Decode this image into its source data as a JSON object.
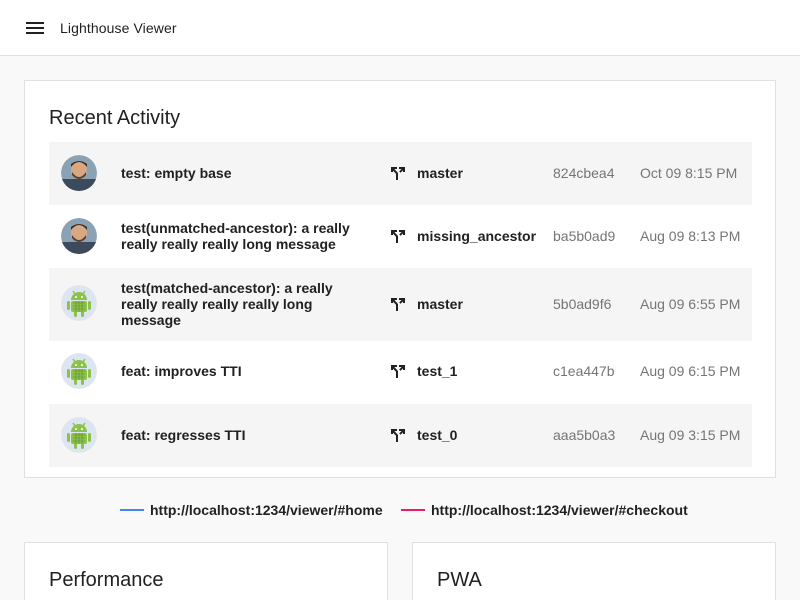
{
  "app": {
    "title": "Lighthouse Viewer"
  },
  "activity": {
    "title": "Recent Activity",
    "rows": [
      {
        "avatar": "person-avatar",
        "message": "test: empty base",
        "branch": "master",
        "hash": "824cbea4",
        "date": "Oct 09 8:15 PM"
      },
      {
        "avatar": "person-avatar",
        "message": "test(unmatched-ancestor): a really really really really long message",
        "branch": "missing_ancestor",
        "hash": "ba5b0ad9",
        "date": "Aug 09 8:13 PM"
      },
      {
        "avatar": "android-avatar",
        "message": "test(matched-ancestor): a really really really really really long message",
        "branch": "master",
        "hash": "5b0ad9f6",
        "date": "Aug 09 6:55 PM"
      },
      {
        "avatar": "android-avatar",
        "message": "feat: improves TTI",
        "branch": "test_1",
        "hash": "c1ea447b",
        "date": "Aug 09 6:15 PM"
      },
      {
        "avatar": "android-avatar",
        "message": "feat: regresses TTI",
        "branch": "test_0",
        "hash": "aaa5b0a3",
        "date": "Aug 09 3:15 PM"
      }
    ]
  },
  "legend": [
    {
      "label": "http://localhost:1234/viewer/#home",
      "color": "#4285f4"
    },
    {
      "label": "http://localhost:1234/viewer/#checkout",
      "color": "#e91e63"
    }
  ],
  "cards": {
    "performance": {
      "title": "Performance"
    },
    "pwa": {
      "title": "PWA"
    }
  }
}
